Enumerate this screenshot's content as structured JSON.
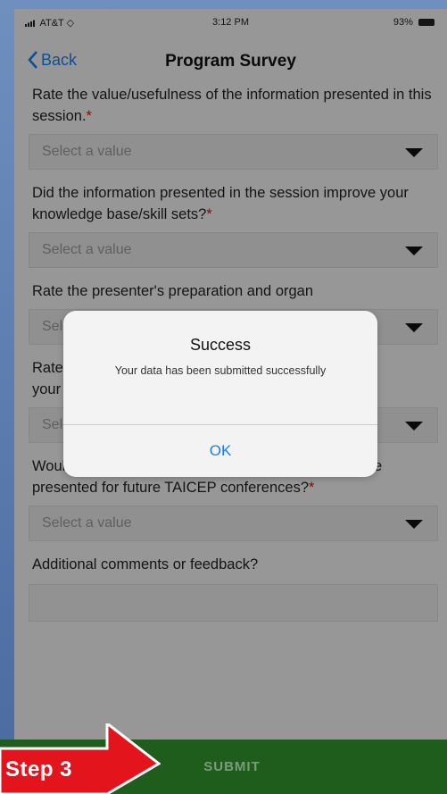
{
  "status_bar": {
    "carrier": "AT&T",
    "time": "3:12 PM",
    "battery": "93%"
  },
  "nav": {
    "back_label": "Back",
    "title": "Program Survey"
  },
  "questions": [
    {
      "text": "Rate the value/usefulness of the information presented in this session.",
      "required": "*",
      "placeholder": "Select a value"
    },
    {
      "text": "Did the information presented in the session improve your knowledge base/skill sets?",
      "required": "*",
      "placeholder": "Select a value"
    },
    {
      "text": "Rate the presenter's preparation and organ",
      "required": "",
      "placeholder": "Sele"
    },
    {
      "text": "Rate your",
      "required": "",
      "placeholder": "Select a value"
    },
    {
      "text": "Would you recommend this session/ information to be presented for future TAICEP conferences?",
      "required": "*",
      "placeholder": "Select a value"
    }
  ],
  "comments": {
    "label": "Additional comments or feedback?"
  },
  "alert": {
    "title": "Success",
    "message": "Your data has been submitted successfully",
    "ok_label": "OK"
  },
  "submit": {
    "label": "SUBMIT"
  },
  "step": {
    "label": "Step 3"
  },
  "colors": {
    "accent": "#1a7ef0",
    "required": "#dd1111",
    "submit_bar": "#1f5d1c",
    "step_arrow": "#e3141b"
  }
}
